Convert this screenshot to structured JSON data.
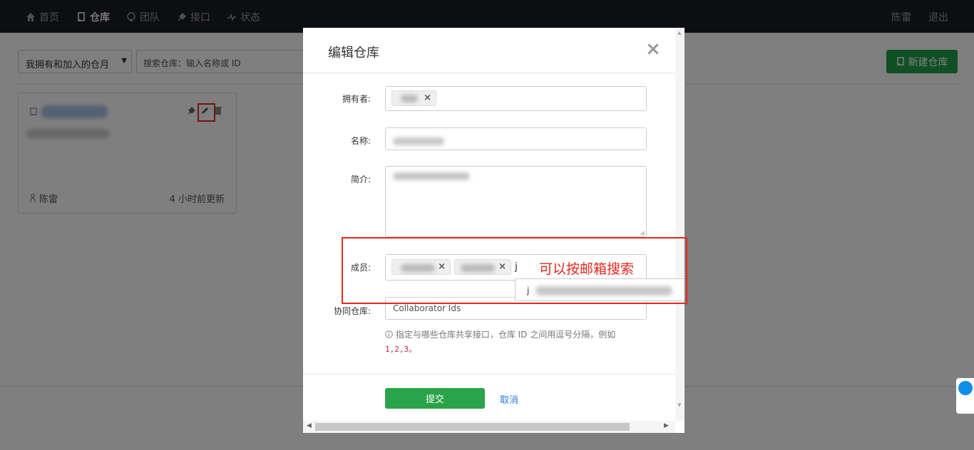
{
  "navbar": {
    "items": [
      {
        "label": "首页",
        "icon": "home-icon"
      },
      {
        "label": "仓库",
        "icon": "book-icon",
        "active": true
      },
      {
        "label": "团队",
        "icon": "team-icon"
      },
      {
        "label": "接口",
        "icon": "plug-icon"
      },
      {
        "label": "状态",
        "icon": "pulse-icon"
      }
    ],
    "user": "陈雷",
    "logout": "退出"
  },
  "toolbar": {
    "filter_value": "我拥有和加入的仓月",
    "search_placeholder": "搜索仓库：输入名称或 ID",
    "new_repo_label": "新建仓库"
  },
  "card": {
    "owner": "陈雷",
    "updated": "4 小时前更新"
  },
  "modal": {
    "title": "编辑仓库",
    "close_glyph": "×",
    "owner_label": "拥有者:",
    "name_label": "名称:",
    "intro_label": "简介:",
    "members_label": "成员:",
    "members_typed": "j",
    "dropdown_text": "j",
    "collab_label": "协同仓库:",
    "collab_placeholder": "Collaborator Ids",
    "help_text": "指定与哪些仓库共享接口，仓库 ID 之间用逗号分隔，例如",
    "help_example": "1,2,3。",
    "submit_label": "提交",
    "cancel_label": "取消"
  },
  "annotation": {
    "text": "可以按邮箱搜索",
    "color": "#e8271f"
  },
  "colors": {
    "navbar_bg": "#1a1d22",
    "primary_green": "#1e9e48",
    "link_blue": "#2b7bd6"
  }
}
